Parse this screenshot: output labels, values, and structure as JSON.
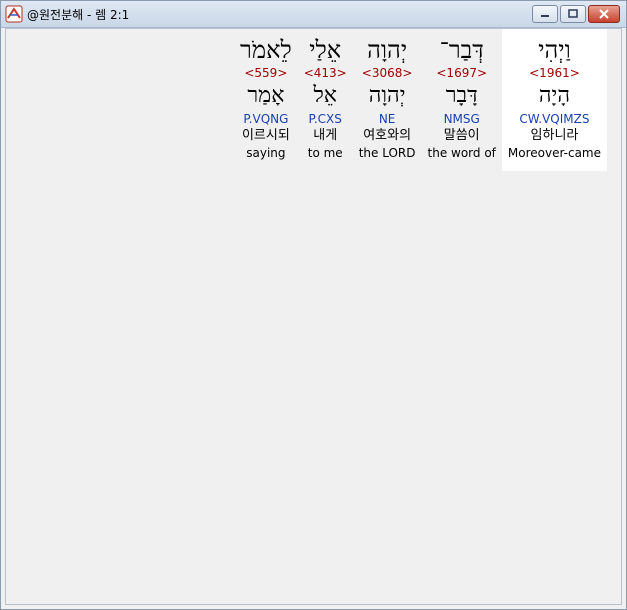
{
  "window": {
    "title": "@원전분해 - 렘 2:1",
    "icon": "parallel-text-app-icon",
    "controls": [
      "minimize-icon",
      "maximize-icon",
      "close-icon"
    ]
  },
  "colors": {
    "strong_number": "#a00000",
    "morphology": "#1a3fb0",
    "selected_background": "#ffffff"
  },
  "words": [
    {
      "hebrew": "וַיְהִי",
      "strong": "<1961>",
      "lemma": "הָיָה",
      "morph": "CW.VQIMZS",
      "korean": "임하니라",
      "english": "Moreover-came",
      "selected": true
    },
    {
      "hebrew": "דְּבַר־",
      "strong": "<1697>",
      "lemma": "דָּבָר",
      "morph": "NMSG",
      "korean": "말씀이",
      "english": "the word of",
      "selected": false
    },
    {
      "hebrew": "יְהוָה",
      "strong": "<3068>",
      "lemma": "יְהוָה",
      "morph": "NE",
      "korean": "여호와의",
      "english": "the LORD",
      "selected": false
    },
    {
      "hebrew": "אֵלַי",
      "strong": "<413>",
      "lemma": "אֵל",
      "morph": "P.CXS",
      "korean": "내게",
      "english": "to me",
      "selected": false
    },
    {
      "hebrew": "לֵאמֹר",
      "strong": "<559>",
      "lemma": "אָמַר",
      "morph": "P.VQNG",
      "korean": "이르시되",
      "english": "saying",
      "selected": false
    }
  ]
}
